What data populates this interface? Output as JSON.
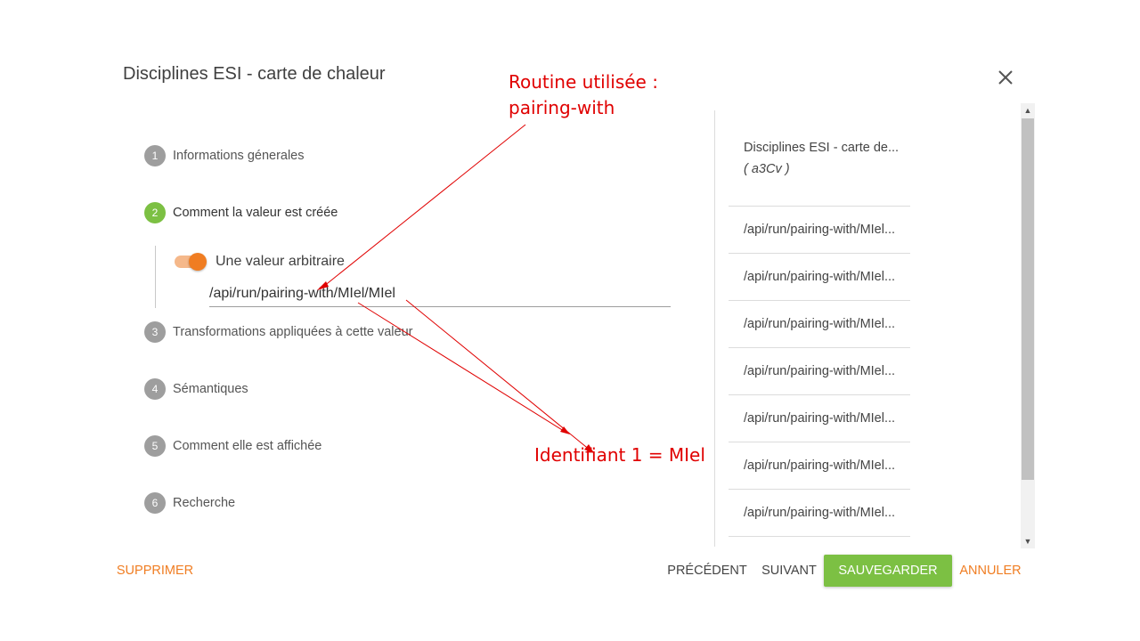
{
  "dialog": {
    "title": "Disciplines ESI - carte de chaleur"
  },
  "steps": [
    {
      "number": "1",
      "label": "Informations génerales"
    },
    {
      "number": "2",
      "label": "Comment la valeur est créée"
    },
    {
      "number": "3",
      "label": "Transformations appliquées à cette valeur"
    },
    {
      "number": "4",
      "label": "Sémantiques"
    },
    {
      "number": "5",
      "label": "Comment elle est affichée"
    },
    {
      "number": "6",
      "label": "Recherche"
    }
  ],
  "active_step": 2,
  "step2_content": {
    "toggle_label": "Une valeur arbitraire",
    "toggle_on": true,
    "value": "/api/run/pairing-with/MIel/MIel"
  },
  "sidebar": {
    "header_title": "Disciplines ESI - carte de...",
    "header_subtitle": "( a3Cv )",
    "items": [
      "/api/run/pairing-with/MIel...",
      "/api/run/pairing-with/MIel...",
      "/api/run/pairing-with/MIel...",
      "/api/run/pairing-with/MIel...",
      "/api/run/pairing-with/MIel...",
      "/api/run/pairing-with/MIel...",
      "/api/run/pairing-with/MIel..."
    ]
  },
  "footer": {
    "delete_label": "SUPPRIMER",
    "previous_label": "PRÉCÉDENT",
    "next_label": "SUIVANT",
    "save_label": "SAUVEGARDER",
    "cancel_label": "ANNULER"
  },
  "annotations": {
    "routine_line1": "Routine utilisée :",
    "routine_line2": "pairing-with",
    "identifier": "Identifiant 1 = MIel"
  },
  "colors": {
    "accent_orange": "#f07d22",
    "active_green": "#7cc043",
    "inactive_grey": "#9e9e9e",
    "annotation_red": "#e00000"
  },
  "icons": {
    "close": "close-icon",
    "scroll_up": "chevron-up-icon",
    "scroll_down": "chevron-down-icon"
  }
}
